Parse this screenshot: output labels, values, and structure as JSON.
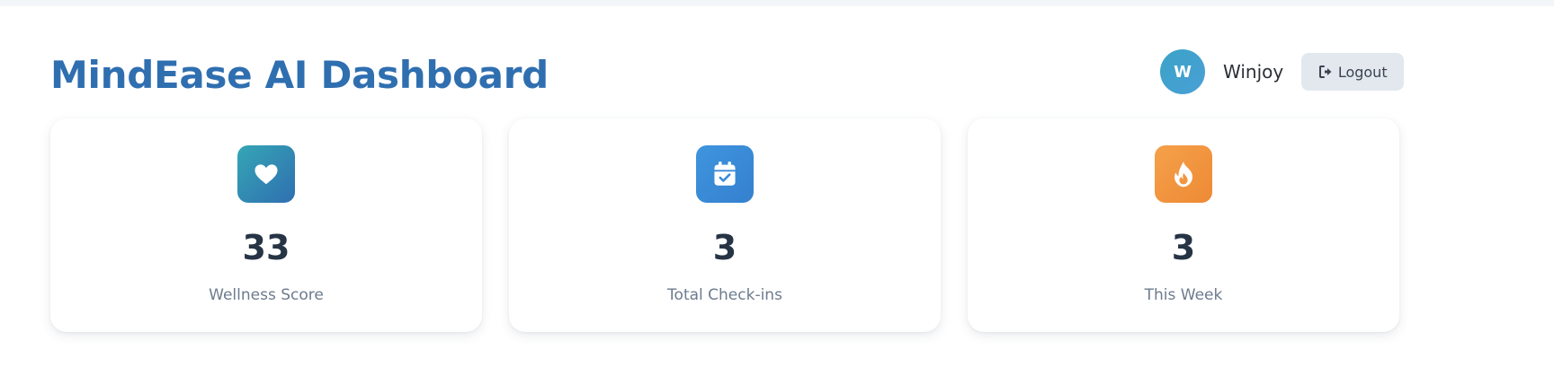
{
  "header": {
    "title": "MindEase AI Dashboard"
  },
  "user": {
    "avatar_initial": "W",
    "name": "Winjoy",
    "logout_label": "Logout"
  },
  "stats": [
    {
      "icon": "heart-icon",
      "value": "33",
      "label": "Wellness Score",
      "color": "#2f8fb3"
    },
    {
      "icon": "calendar-check-icon",
      "value": "3",
      "label": "Total Check-ins",
      "color": "#3a8ad8"
    },
    {
      "icon": "flame-icon",
      "value": "3",
      "label": "This Week",
      "color": "#f2963f"
    }
  ],
  "colors": {
    "title": "#2f6fb0",
    "value_text": "#263445",
    "label_text": "#6d7b8e",
    "logout_bg": "#e3e8ef"
  }
}
